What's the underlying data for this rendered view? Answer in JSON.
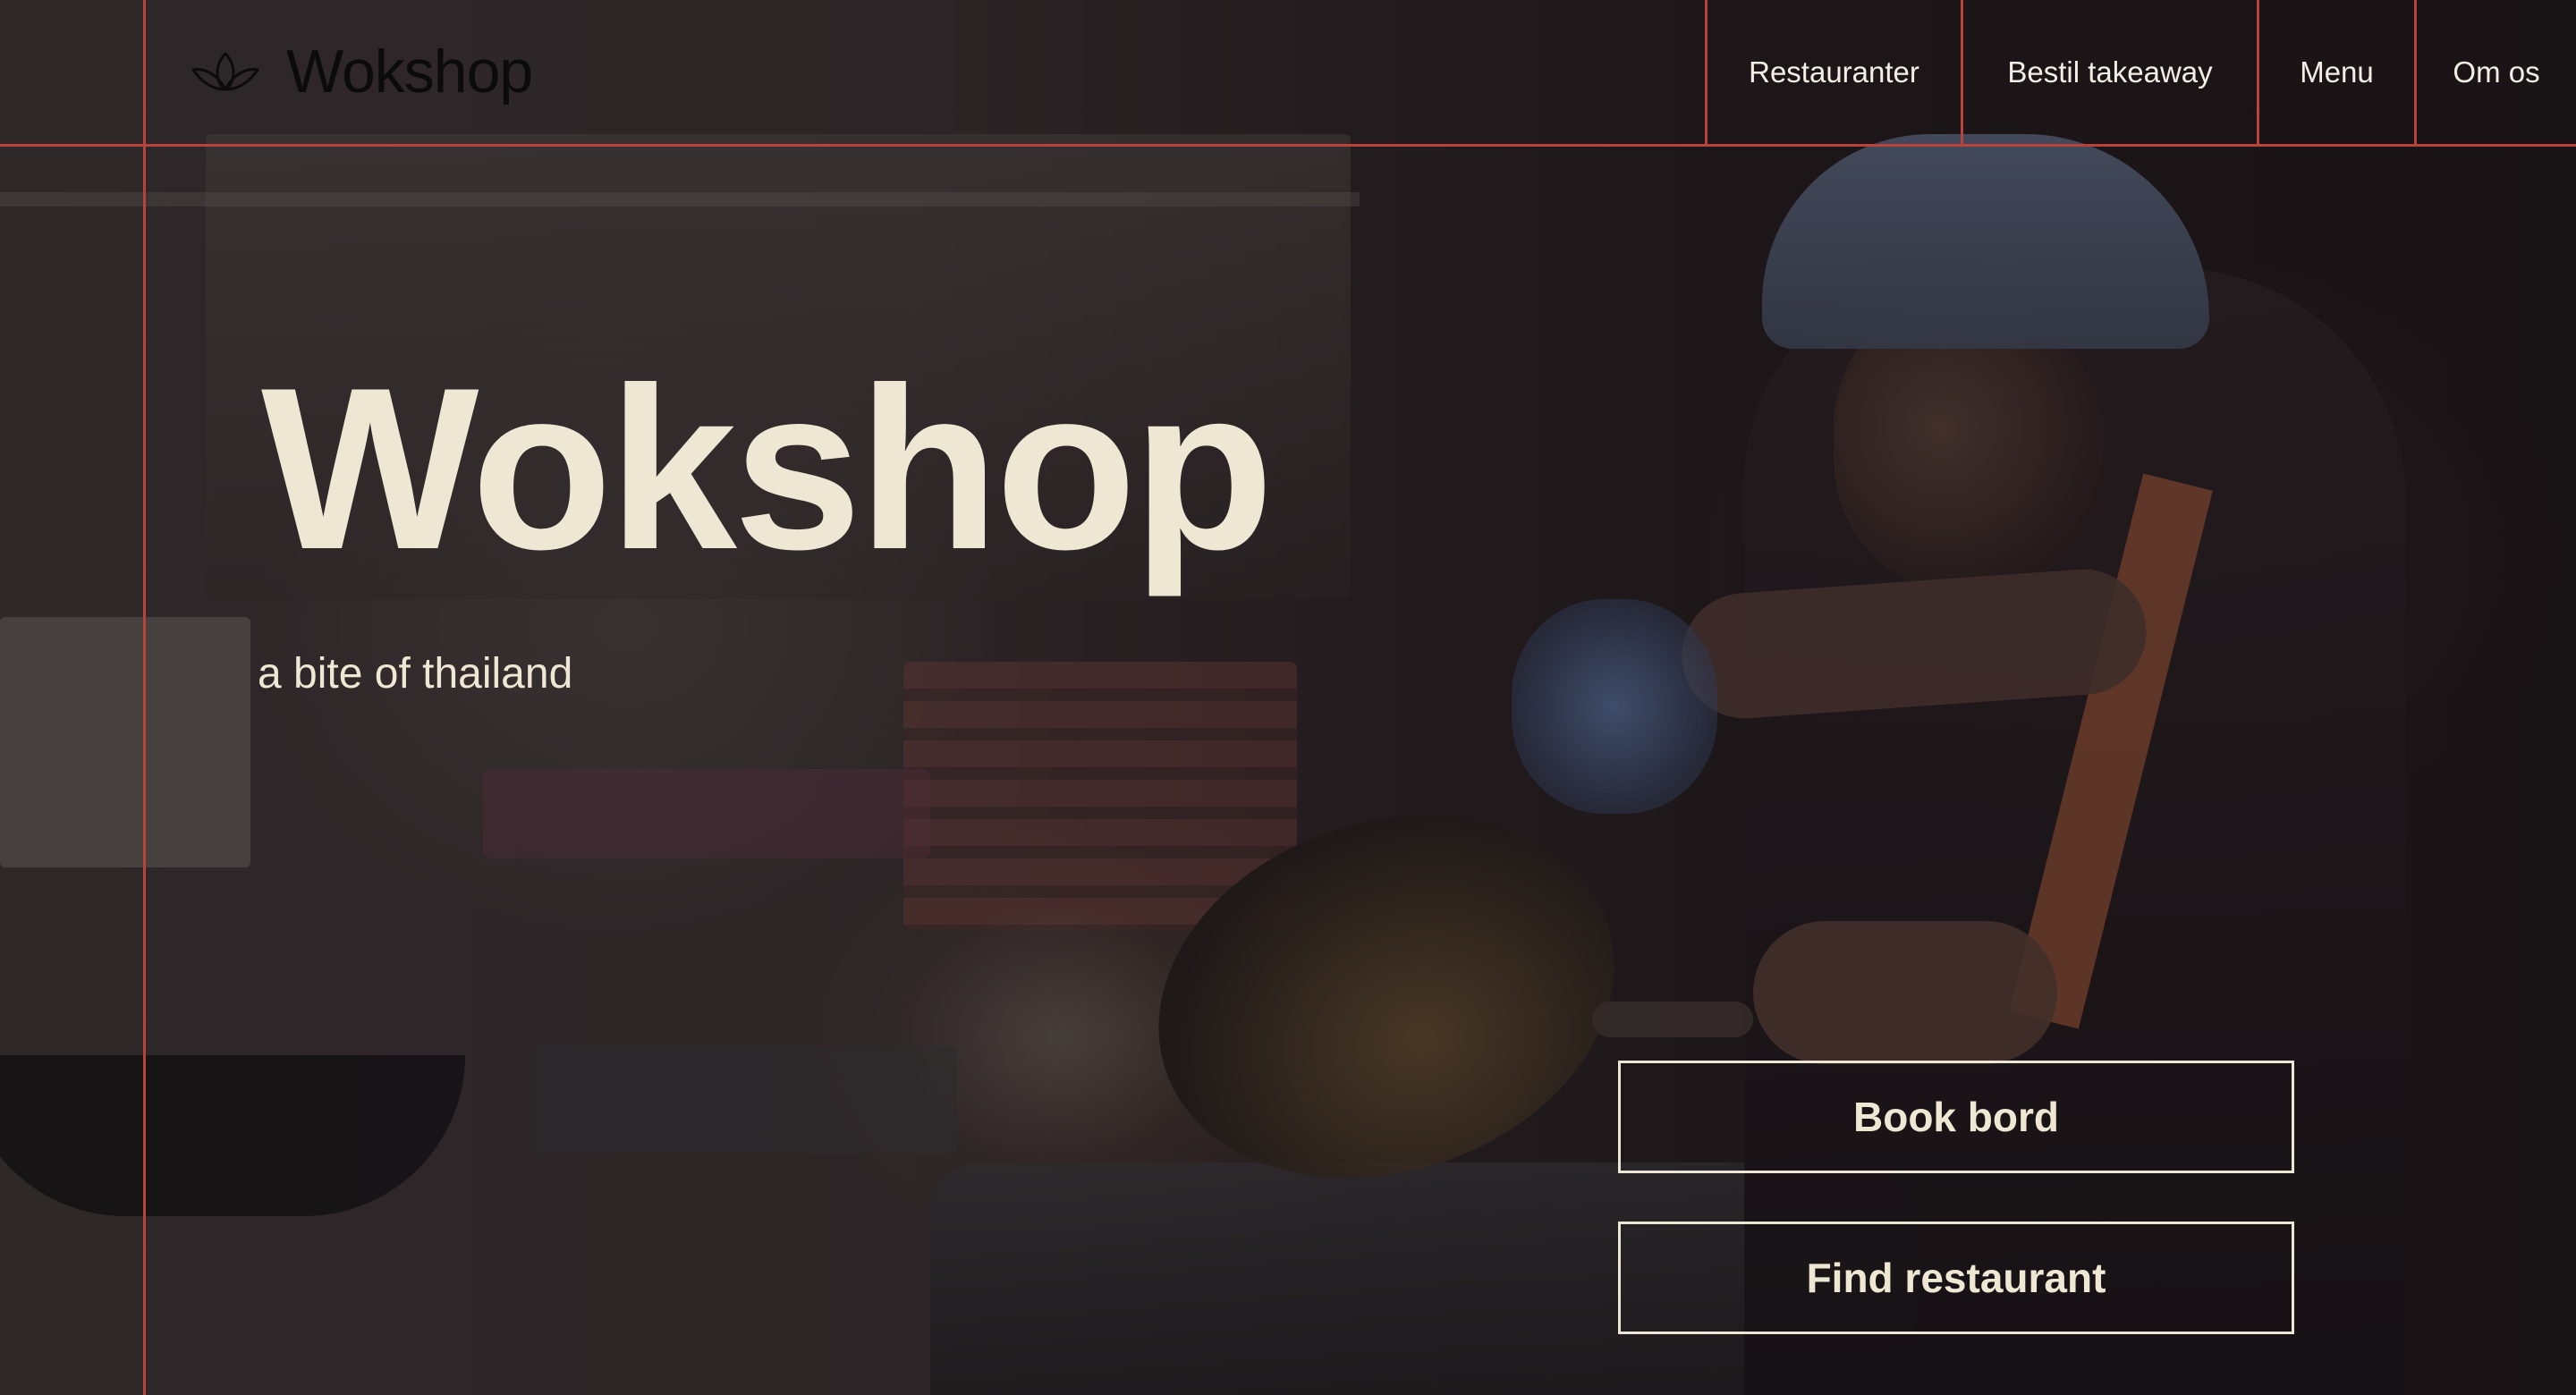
{
  "header": {
    "brand_name": "Wokshop",
    "brand_logo_icon": "lotus-icon",
    "nav": [
      {
        "label": "Restauranter"
      },
      {
        "label": "Bestil takeaway"
      },
      {
        "label": "Menu"
      },
      {
        "label": "Om os"
      }
    ]
  },
  "hero": {
    "title": "Wokshop",
    "tagline": "a bite of thailand",
    "buttons": {
      "book_label": "Book bord",
      "find_label": "Find restaurant"
    }
  },
  "colors": {
    "accent_line": "#b9433c",
    "text_cream": "#ede7d3",
    "brand_text": "#0b0b0b",
    "background_dark": "#1c1719"
  }
}
